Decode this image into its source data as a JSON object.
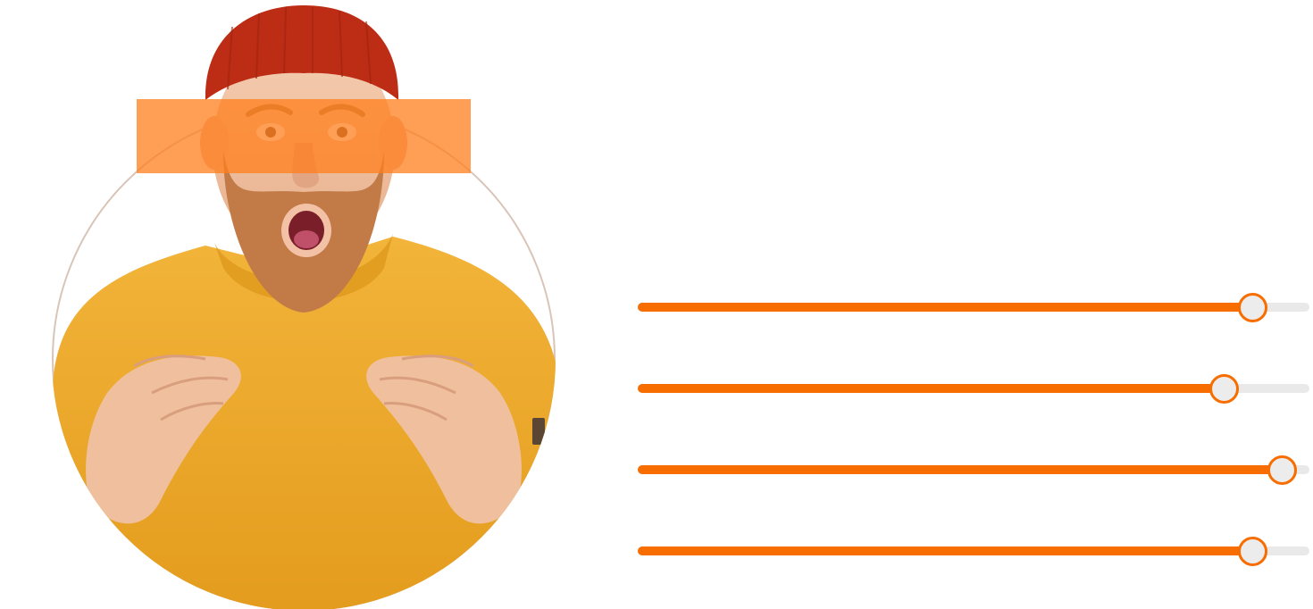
{
  "colors": {
    "accent": "#f76d00",
    "track": "#e9e9e9",
    "thumb_fill": "#ececec",
    "sweater": "#e9a626",
    "beanie": "#bd2c14",
    "beard": "#c27a47",
    "skin": "#f1c3a0",
    "eye_bar": "#ff7f1e"
  },
  "photo": {
    "icon": "surprised-man-photo",
    "eye_bar_opacity": 0.75
  },
  "sliders": [
    {
      "name": "slider-1",
      "value": 0.914
    },
    {
      "name": "slider-2",
      "value": 0.871
    },
    {
      "name": "slider-3",
      "value": 0.957
    },
    {
      "name": "slider-4",
      "value": 0.914
    }
  ]
}
